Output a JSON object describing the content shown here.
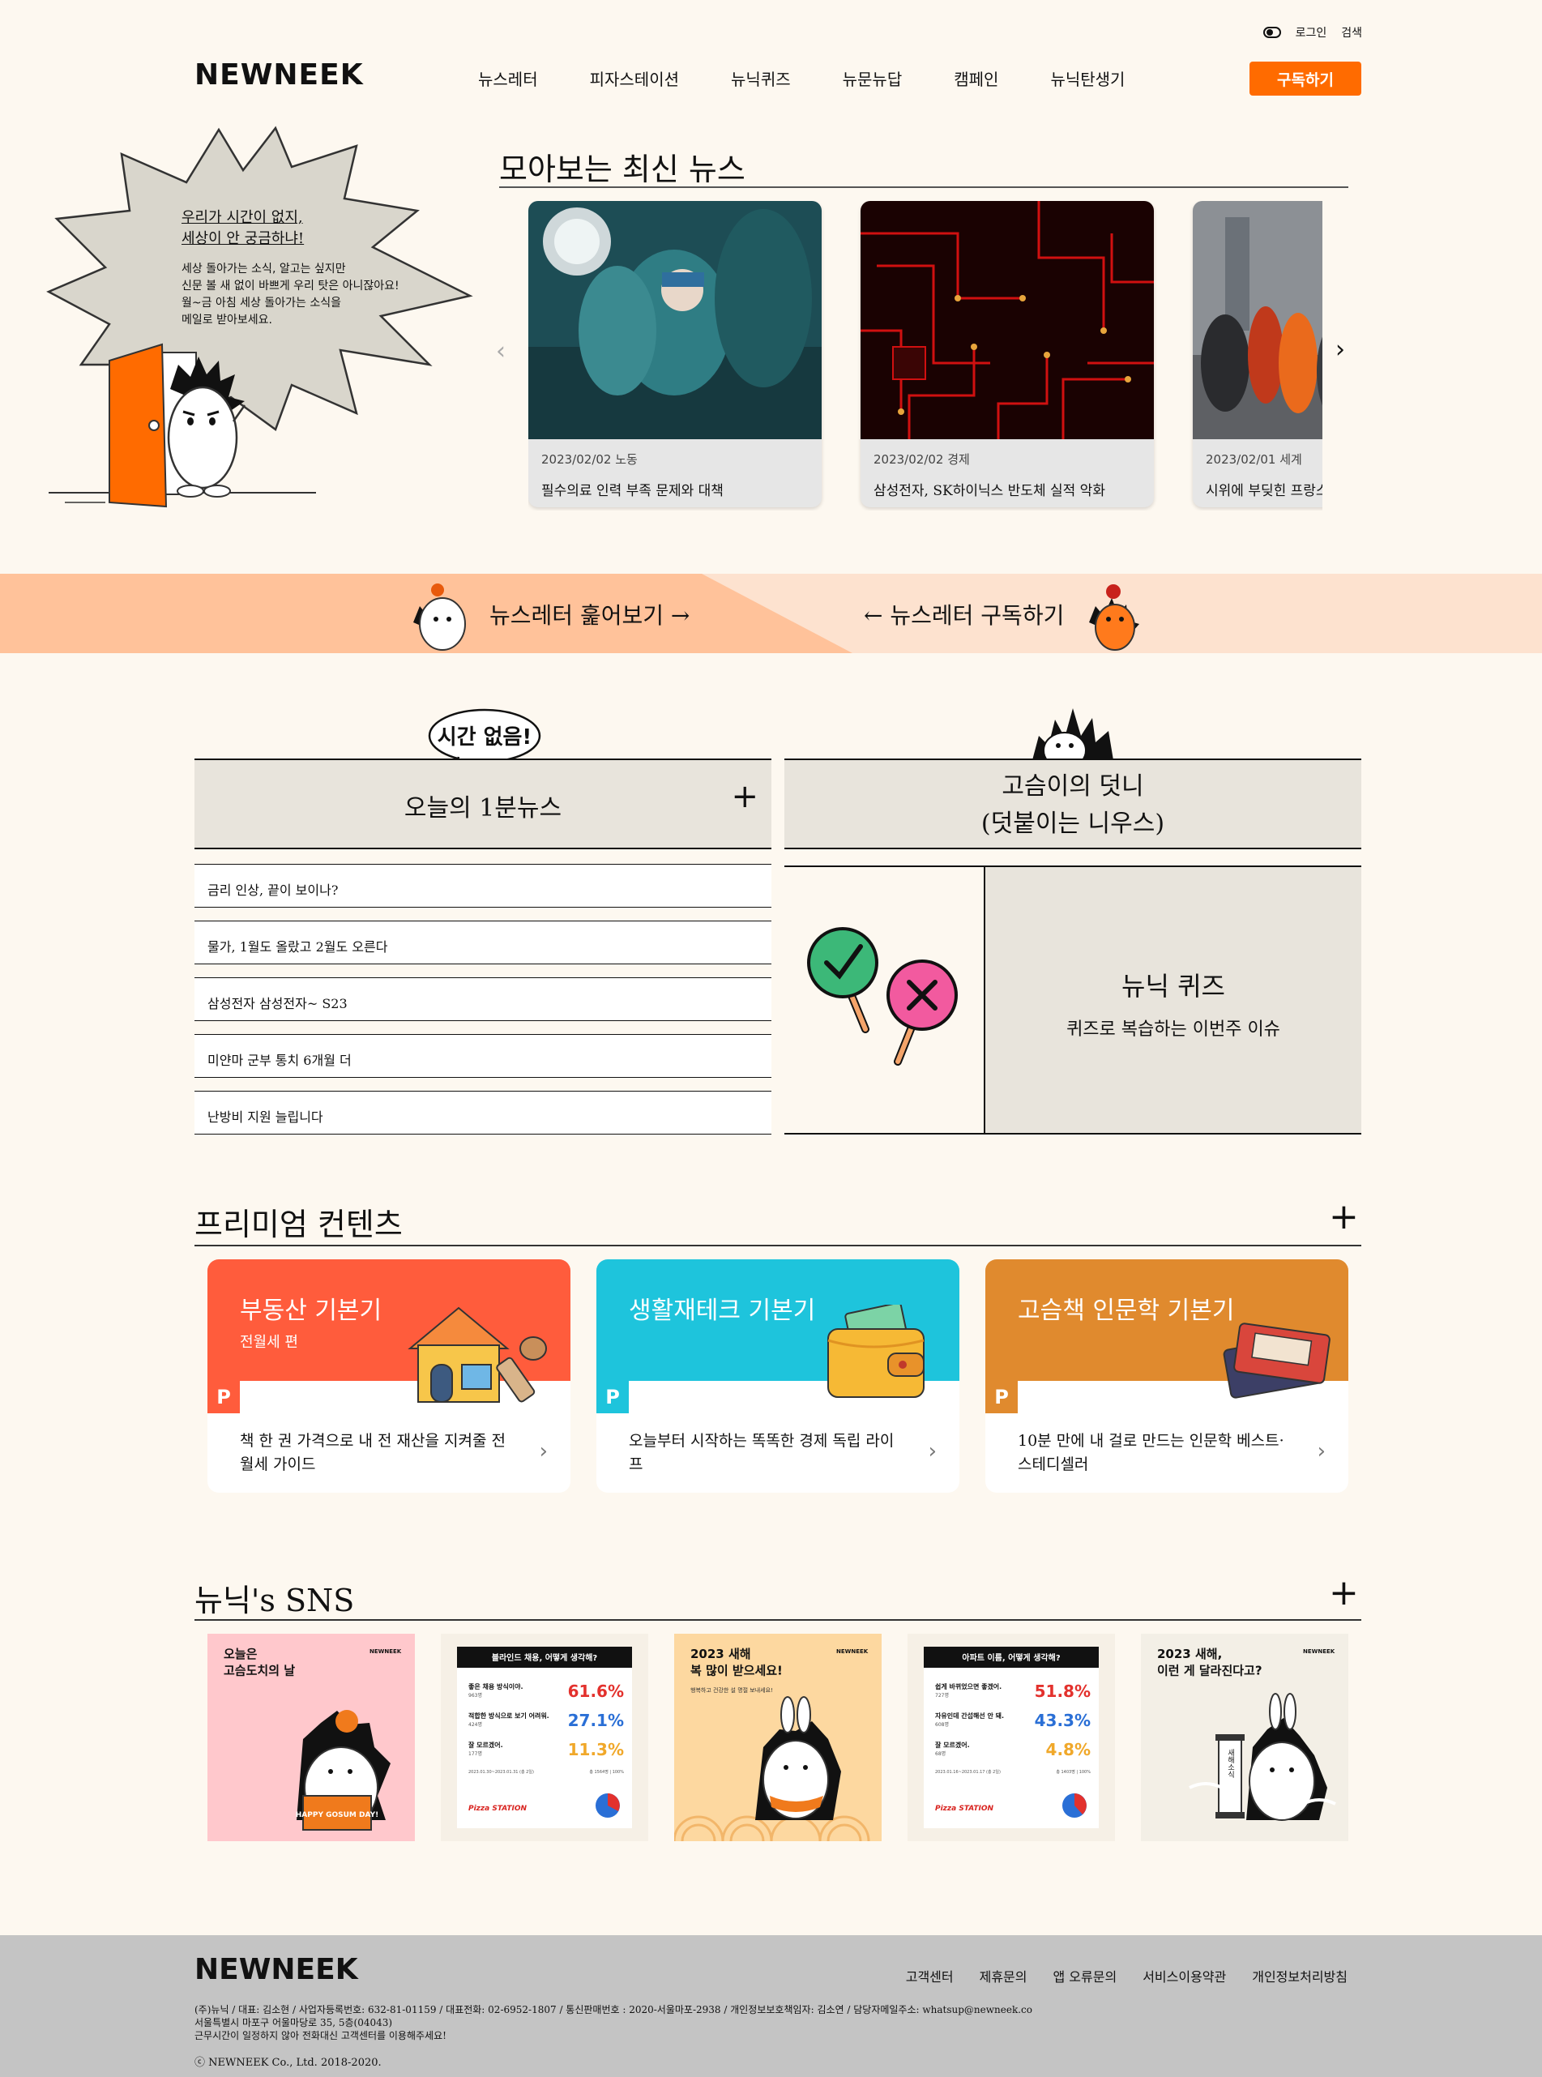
{
  "header": {
    "theme_toggle": "theme-toggle",
    "login": "로그인",
    "search": "검색",
    "logo": "NEWNEEK",
    "nav": [
      "뉴스레터",
      "피자스테이션",
      "뉴닉퀴즈",
      "뉴문뉴답",
      "캠페인",
      "뉴닉탄생기"
    ],
    "subscribe": "구독하기"
  },
  "hero": {
    "bubble_line1": "우리가 시간이 없지,",
    "bubble_line2": "세상이 안 궁금하냐!",
    "bubble_body": [
      "세상 돌아가는 소식, 알고는 싶지만",
      "신문 볼 새 없이 바쁘게 우리 탓은 아니잖아요!",
      "월~금 아침 세상 돌아가는 소식을",
      "메일로 받아보세요."
    ]
  },
  "latest": {
    "title": "모아보는 최신 뉴스",
    "cards": [
      {
        "meta": "2023/02/02 노동",
        "title": "필수의료 인력 부족 문제와 대책"
      },
      {
        "meta": "2023/02/02 경제",
        "title": "삼성전자, SK하이닉스 반도체 실적 악화"
      },
      {
        "meta": "2023/02/01 세계",
        "title": "시위에 부딪힌 프랑스 연금개혁"
      }
    ]
  },
  "band": {
    "left": "뉴스레터 훑어보기 →",
    "right": "← 뉴스레터 구독하기"
  },
  "quick_news": {
    "badge": "시간 없음!",
    "title": "오늘의 1분뉴스",
    "items": [
      "금리 인상, 끝이 보이나?",
      "물가, 1월도 올랐고 2월도 오른다",
      "삼성전자 삼성전자~ S23",
      "미얀마 군부 통치 6개월 더",
      "난방비 지원 늘립니다"
    ]
  },
  "hedgehog": {
    "title_line1": "고슴이의 덧니",
    "title_line2": "(덧붙이는 니우스)",
    "quiz_title": "뉴닉 퀴즈",
    "quiz_sub": "퀴즈로 복습하는 이번주 이슈"
  },
  "premium": {
    "title": "프리미엄 컨텐츠",
    "badge": "P",
    "cards": [
      {
        "title": "부동산 기본기",
        "sub": "전월세 편",
        "desc": "책 한 권 가격으로 내 전 재산을 지켜줄 전월세 가이드",
        "color": "#ff5c3c"
      },
      {
        "title": "생활재테크 기본기",
        "sub": "",
        "desc": "오늘부터 시작하는 똑똑한 경제 독립 라이프",
        "color": "#1ec4dc"
      },
      {
        "title": "고슴책 인문학 기본기",
        "sub": "",
        "desc": "10분 만에 내 걸로 만드는 인문학 베스트·스테디셀러",
        "color": "#e08a2e"
      }
    ]
  },
  "sns": {
    "title": "뉴닉's SNS",
    "brand": "NEWNEEK",
    "post1": {
      "title": "오늘은\n고슴도치의 날",
      "sign": "HAPPY GOSUM DAY!"
    },
    "post2": {
      "title": "블라인드 채용, 어떻게 생각해?",
      "rows": [
        [
          "좋은 채용 방식이야.",
          "963명",
          "61.6%"
        ],
        [
          "적합한 방식으로 보기 어려워.",
          "424명",
          "27.1%"
        ],
        [
          "잘 모르겠어.",
          "177명",
          "11.3%"
        ]
      ],
      "period": "2023.01.30~2023.01.31 (총 2일)",
      "total": "총 1564명 | 100%",
      "sponsor": "Pizza STATION"
    },
    "post3": {
      "title": "2023 새해\n복 많이 받으세요!",
      "sub": "행복하고 건강한 설 명절 보내세요!"
    },
    "post4": {
      "title": "아파트 이름, 어떻게 생각해?",
      "rows": [
        [
          "쉽게 바뀌었으면 좋겠어.",
          "727명",
          "51.8%"
        ],
        [
          "자유인데 간섭해선 안 돼.",
          "608명",
          "43.3%"
        ],
        [
          "잘 모르겠어.",
          "68명",
          "4.8%"
        ]
      ],
      "period": "2023.01.16~2023.01.17 (총 2일)",
      "total": "총 1403명 | 100%",
      "sponsor": "Pizza STATION"
    },
    "post5": {
      "title": "2023 새해,\n이런 게 달라진다고?",
      "scroll": "새해소식"
    }
  },
  "footer": {
    "logo": "NEWNEEK",
    "links": [
      "고객센터",
      "제휴문의",
      "앱 오류문의",
      "서비스이용약관",
      "개인정보처리방침"
    ],
    "info1": "(주)뉴닉 / 대표: 김소현 / 사업자등록번호: 632-81-01159 / 대표전화: 02-6952-1807 / 통신판매번호 : 2020-서울마포-2938 / 개인정보보호책임자: 김소연 / 담당자메일주소: whatsup@newneek.co",
    "info2": "서울특별시 마포구 어울마당로 35, 5층(04043)",
    "info3": "근무시간이 일정하지 않아 전화대신 고객센터를 이용해주세요!",
    "copyright": "ⓒ NEWNEEK Co., Ltd. 2018-2020."
  }
}
